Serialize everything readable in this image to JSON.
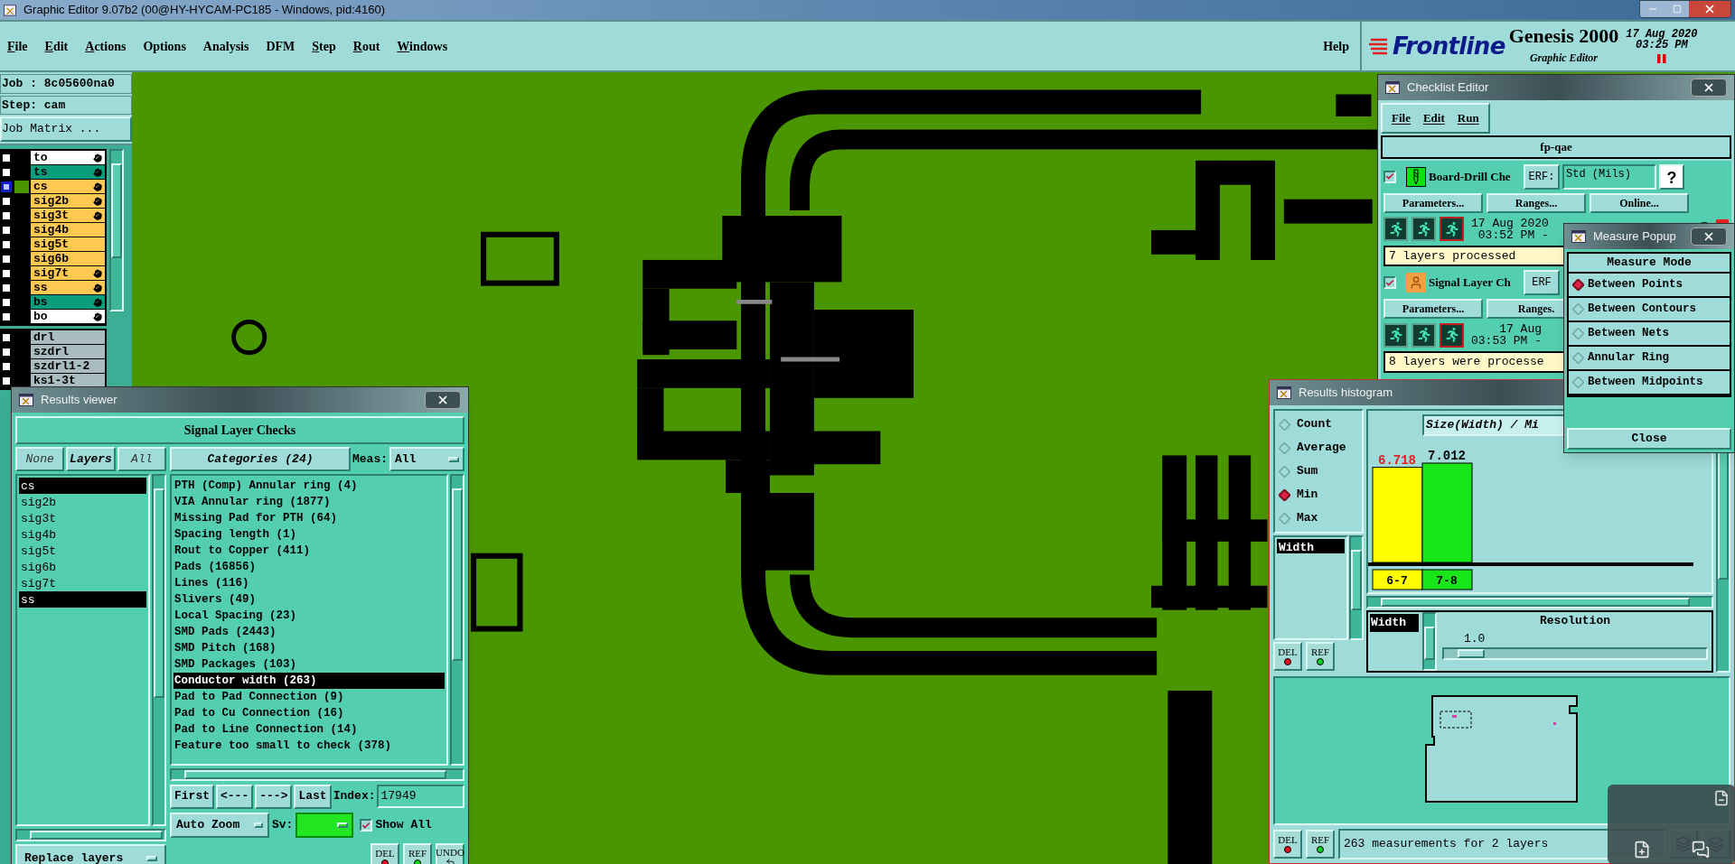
{
  "window": {
    "title": "Graphic Editor 9.07b2 (00@HY-HYCAM-PC185 - Windows, pid:4160)"
  },
  "menu": [
    {
      "label": "File",
      "underlined": true
    },
    {
      "label": "Edit",
      "underlined": true
    },
    {
      "label": "Actions",
      "underlined": true
    },
    {
      "label": "Options",
      "underlined": false
    },
    {
      "label": "Analysis",
      "underlined": false
    },
    {
      "label": "DFM",
      "underlined": false
    },
    {
      "label": "Step",
      "underlined": true
    },
    {
      "label": "Rout",
      "underlined": true
    },
    {
      "label": "Windows",
      "underlined": true
    }
  ],
  "help": "Help",
  "brand": {
    "logo": "Frontline",
    "product": "Genesis 2000",
    "subtitle": "Graphic Editor",
    "date": "17 Aug 2020",
    "time": "03:25 PM"
  },
  "job": {
    "job": "Job : 8c05600na0",
    "step": "Step: cam",
    "matrix_button": "Job Matrix ..."
  },
  "layers": [
    {
      "name": "to",
      "color": "#ffffff",
      "selected": false,
      "work": false,
      "pointer": true
    },
    {
      "name": "ts",
      "color": "#0a9e7c",
      "selected": false,
      "work": false,
      "pointer": true
    },
    {
      "name": "cs",
      "color": "#ffc850",
      "selected": true,
      "work": true,
      "pointer": true
    },
    {
      "name": "sig2b",
      "color": "#ffc850",
      "selected": false,
      "work": false,
      "pointer": true
    },
    {
      "name": "sig3t",
      "color": "#ffc850",
      "selected": false,
      "work": false,
      "pointer": true
    },
    {
      "name": "sig4b",
      "color": "#ffc850",
      "selected": false,
      "work": false,
      "pointer": false
    },
    {
      "name": "sig5t",
      "color": "#ffc850",
      "selected": false,
      "work": false,
      "pointer": false
    },
    {
      "name": "sig6b",
      "color": "#ffc850",
      "selected": false,
      "work": false,
      "pointer": false
    },
    {
      "name": "sig7t",
      "color": "#ffc850",
      "selected": false,
      "work": false,
      "pointer": true
    },
    {
      "name": "ss",
      "color": "#ffc850",
      "selected": false,
      "work": false,
      "pointer": true
    },
    {
      "name": "bs",
      "color": "#0a9e7c",
      "selected": false,
      "work": false,
      "pointer": true
    },
    {
      "name": "bo",
      "color": "#ffffff",
      "selected": false,
      "work": false,
      "pointer": true
    }
  ],
  "drill_layers": [
    {
      "name": "drl",
      "color": "#a9bcc0",
      "selected": false
    },
    {
      "name": "szdrl",
      "color": "#a9bcc0",
      "selected": false
    },
    {
      "name": "szdrl1-2",
      "color": "#a9bcc0",
      "selected": false
    },
    {
      "name": "ks1-3t",
      "color": "#a9bcc0",
      "selected": false
    }
  ],
  "results_viewer": {
    "title": "Results viewer",
    "header": "Signal Layer Checks",
    "layer_buttons": [
      {
        "label": "None",
        "selected": false
      },
      {
        "label": "Layers",
        "selected": true
      },
      {
        "label": "All",
        "selected": false
      }
    ],
    "layers": [
      {
        "name": "cs",
        "selected": true
      },
      {
        "name": "sig2b",
        "selected": false
      },
      {
        "name": "sig3t",
        "selected": false
      },
      {
        "name": "sig4b",
        "selected": false
      },
      {
        "name": "sig5t",
        "selected": false
      },
      {
        "name": "sig6b",
        "selected": false
      },
      {
        "name": "sig7t",
        "selected": false
      },
      {
        "name": "ss",
        "selected": true
      }
    ],
    "categories_button": "Categories (24)",
    "meas_label": "Meas:",
    "meas_value": "All",
    "categories": [
      {
        "label": "PTH (Comp) Annular ring (4)",
        "selected": false
      },
      {
        "label": "VIA Annular ring (1877)",
        "selected": false
      },
      {
        "label": "Missing Pad for PTH (64)",
        "selected": false
      },
      {
        "label": "Spacing length (1)",
        "selected": false
      },
      {
        "label": "Rout to Copper (411)",
        "selected": false
      },
      {
        "label": "Pads (16856)",
        "selected": false
      },
      {
        "label": "Lines (116)",
        "selected": false
      },
      {
        "label": "Slivers (49)",
        "selected": false
      },
      {
        "label": "Local Spacing (23)",
        "selected": false
      },
      {
        "label": "SMD Pads (2443)",
        "selected": false
      },
      {
        "label": "SMD Pitch (168)",
        "selected": false
      },
      {
        "label": "SMD Packages (103)",
        "selected": false
      },
      {
        "label": "Conductor width (263)",
        "selected": true
      },
      {
        "label": "Pad to Pad Connection (9)",
        "selected": false
      },
      {
        "label": "Pad to Cu Connection (16)",
        "selected": false
      },
      {
        "label": "Pad to Line Connection (14)",
        "selected": false
      },
      {
        "label": "Feature too small to check (378)",
        "selected": false
      }
    ],
    "nav": [
      "First",
      "<---",
      "--->",
      "Last"
    ],
    "index_label": "Index:",
    "index_value": "17949",
    "zoom": "Auto Zoom",
    "sv": {
      "label": "Sv:",
      "color": "#22e622"
    },
    "show_all": {
      "label": "Show All",
      "checked": true
    },
    "actions": [
      {
        "label": "DEL",
        "kind": "delete"
      },
      {
        "label": "REF",
        "kind": "refresh"
      },
      {
        "label": "UNDO",
        "kind": "undo"
      }
    ],
    "replace": "Replace layers"
  },
  "checklist_editor": {
    "title": "Checklist Editor",
    "menu": [
      "File",
      "Edit",
      "Run"
    ],
    "name": "fp-qae",
    "checks": [
      {
        "kind": "drill",
        "name": "Board-Drill Che",
        "checked": true,
        "erf": "ERF:",
        "erf_value": "Std (Mils)",
        "help": "?",
        "buttons": [
          "Parameters...",
          "Ranges...",
          "Online..."
        ],
        "date": "17 Aug 2020",
        "time": "03:52 PM -",
        "status": "7 layers processed"
      },
      {
        "kind": "signal",
        "name": "Signal Layer Ch",
        "checked": true,
        "erf": "ERF",
        "buttons": [
          "Parameters...",
          "Ranges."
        ],
        "date": "17 Aug",
        "time": "03:53 PM -",
        "status": "8 layers were processe"
      }
    ]
  },
  "measure_popup": {
    "title": "Measure Popup",
    "header": "Measure Mode",
    "modes": [
      {
        "label": "Between Points",
        "selected": true
      },
      {
        "label": "Between Contours",
        "selected": false
      },
      {
        "label": "Between Nets",
        "selected": false
      },
      {
        "label": "Annular Ring",
        "selected": false
      },
      {
        "label": "Between Midpoints",
        "selected": false
      }
    ],
    "close": "Close"
  },
  "histogram": {
    "title": "Results histogram",
    "modes": [
      {
        "label": "Count",
        "selected": false
      },
      {
        "label": "Average",
        "selected": false
      },
      {
        "label": "Sum",
        "selected": false
      },
      {
        "label": "Min",
        "selected": true
      },
      {
        "label": "Max",
        "selected": false
      }
    ],
    "measures": [
      {
        "label": "Width",
        "selected": true
      }
    ],
    "actions": [
      {
        "label": "DEL",
        "kind": "delete"
      },
      {
        "label": "REF",
        "kind": "refresh"
      }
    ],
    "chart_data": {
      "type": "bar",
      "title": "Size(Width) / Mi",
      "categories": [
        "6-7",
        "7-8"
      ],
      "data_labels": true,
      "series": [
        {
          "color": "#ffff00",
          "values": [
            6.718,
            null
          ]
        },
        {
          "color": "#19e619",
          "values": [
            null,
            7.012
          ]
        }
      ]
    },
    "attribute": {
      "label": "Width",
      "selected": true
    },
    "resolution": {
      "label": "Resolution",
      "value": "1.0",
      "level": 0.05
    },
    "status_actions": [
      {
        "label": "DEL",
        "kind": "delete"
      },
      {
        "label": "REF",
        "kind": "refresh"
      }
    ],
    "status": "263 measurements for 2 layers"
  }
}
